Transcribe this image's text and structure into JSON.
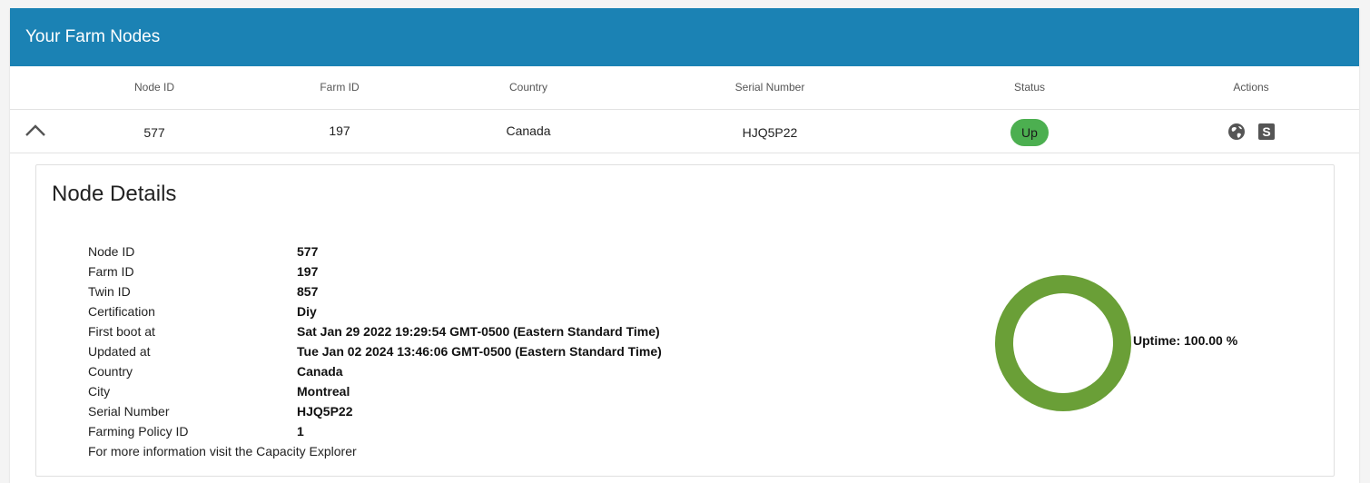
{
  "header": {
    "title": "Your Farm Nodes"
  },
  "table": {
    "columns": [
      "Node ID",
      "Farm ID",
      "Country",
      "Serial Number",
      "Status",
      "Actions"
    ],
    "row": {
      "node_id": "577",
      "farm_id": "197",
      "country": "Canada",
      "serial_number": "HJQ5P22",
      "status": "Up",
      "status_color": "#4caf50",
      "action_icons": [
        "globe-icon",
        "s-icon"
      ]
    }
  },
  "details": {
    "title": "Node Details",
    "fields": [
      {
        "label": "Node ID",
        "value": "577"
      },
      {
        "label": "Farm ID",
        "value": "197"
      },
      {
        "label": "Twin ID",
        "value": "857"
      },
      {
        "label": "Certification",
        "value": "Diy"
      },
      {
        "label": "First boot at",
        "value": "Sat Jan 29 2022 19:29:54 GMT-0500 (Eastern Standard Time)"
      },
      {
        "label": "Updated at",
        "value": "Tue Jan 02 2024 13:46:06 GMT-0500 (Eastern Standard Time)"
      },
      {
        "label": "Country",
        "value": "Canada"
      },
      {
        "label": "City",
        "value": "Montreal"
      },
      {
        "label": "Serial Number",
        "value": "HJQ5P22"
      },
      {
        "label": "Farming Policy ID",
        "value": "1"
      }
    ],
    "note": "For more information visit the Capacity Explorer",
    "uptime": {
      "label": "Uptime: 100.00 %",
      "percent": 100,
      "color": "#6a9f37"
    }
  },
  "colors": {
    "header_bg": "#1b82b4",
    "status_up": "#4caf50",
    "uptime_ring": "#6a9f37"
  }
}
